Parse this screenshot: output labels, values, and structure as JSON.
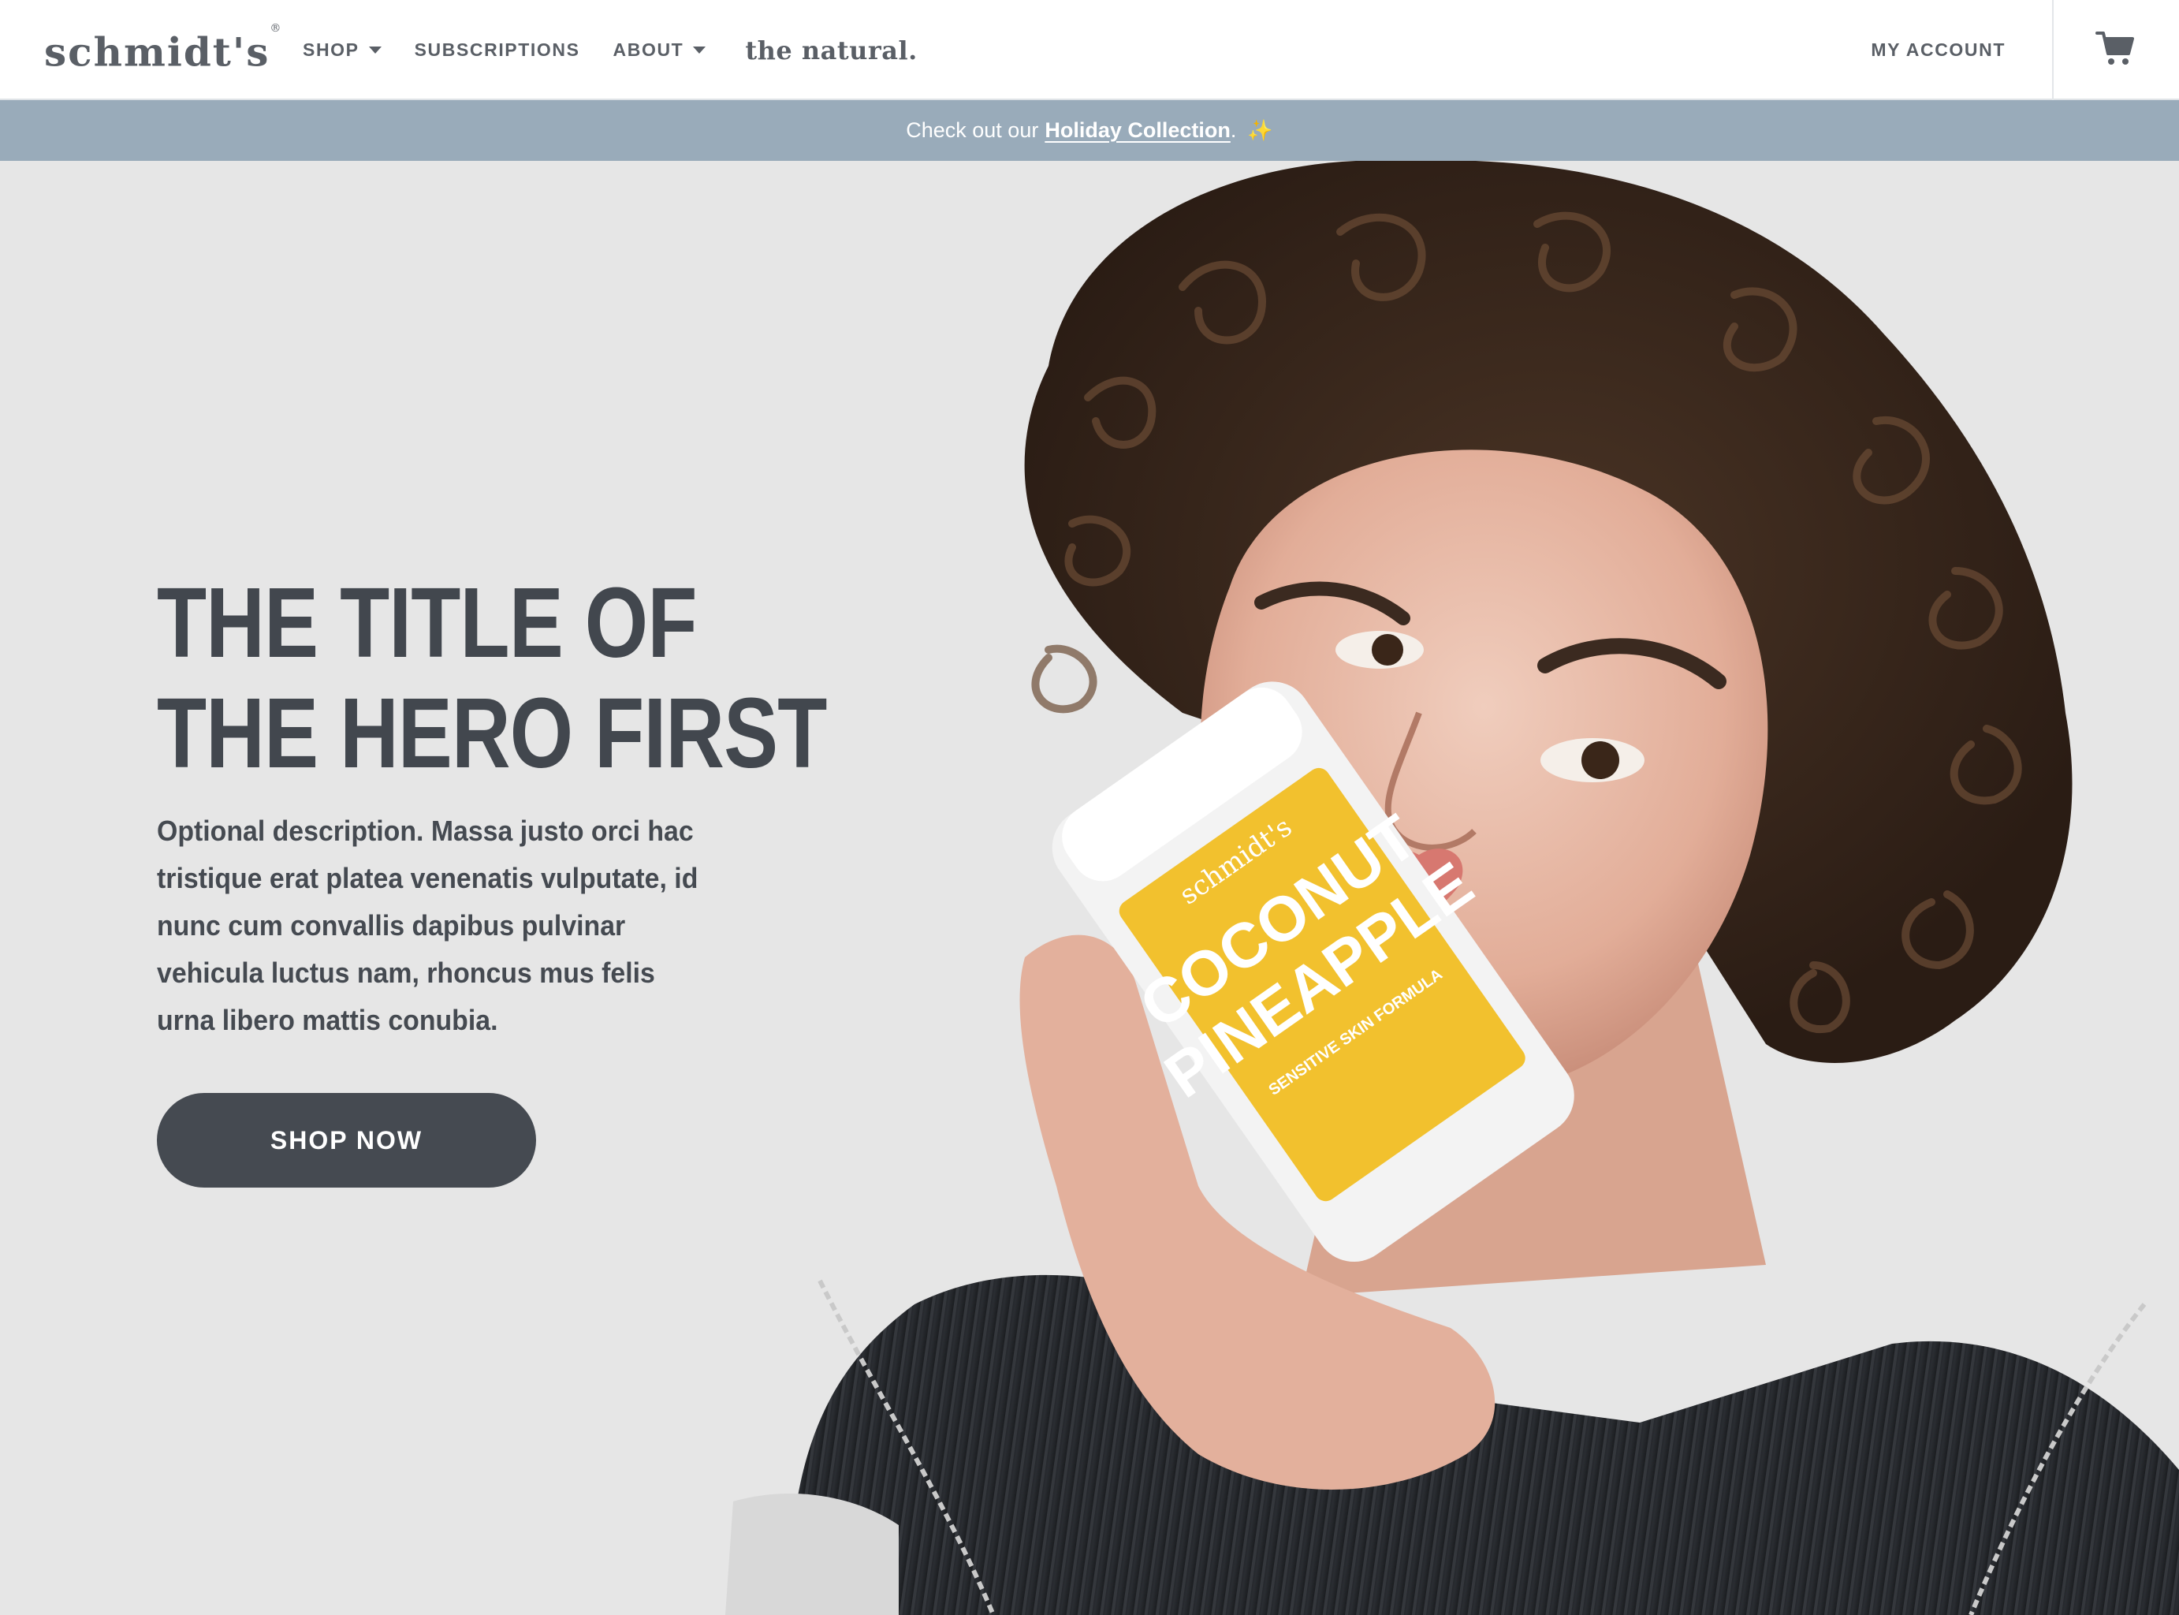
{
  "nav": {
    "logo": "schmidt's",
    "logo_mark": "®",
    "links": [
      {
        "label": "SHOP",
        "dropdown": true
      },
      {
        "label": "SUBSCRIPTIONS",
        "dropdown": false
      },
      {
        "label": "ABOUT",
        "dropdown": true
      }
    ],
    "the_natural": "the natural.",
    "account_label": "MY ACCOUNT",
    "cart_icon": "cart-icon"
  },
  "announcement": {
    "prefix": "Check out our",
    "link_label": "Holiday Collection",
    "suffix": ".",
    "sparkle": "✨"
  },
  "hero": {
    "title": "THE TITLE OF THE HERO FIRST",
    "description": "Optional description. Massa justo orci hac tristique erat platea venenatis vulputate, id nunc cum convallis dapibus pulvinar vehicula luctus nam, rhoncus mus felis urna libero mattis conubia.",
    "cta_label": "SHOP NOW",
    "product_brand": "schmidt's",
    "product_name_1": "COCONUT",
    "product_name_2": "PINEAPPLE",
    "product_sub": "SENSITIVE SKIN FORMULA"
  },
  "colors": {
    "announcement_bg": "#99abba",
    "button_bg": "#454a51",
    "text": "#454a51",
    "hero_bg": "#e6e6e6",
    "product_label": "#f2c12e"
  }
}
